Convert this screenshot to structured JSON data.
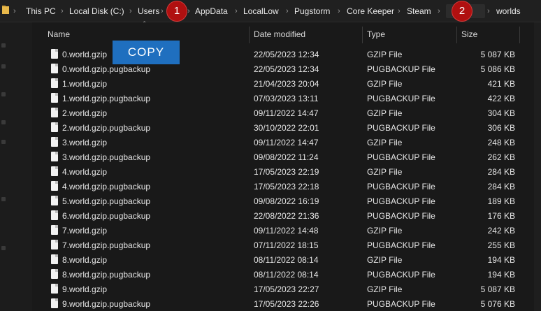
{
  "breadcrumb": {
    "items": [
      "This PC",
      "Local Disk (C:)",
      "Users",
      "AppData",
      "LocalLow",
      "Pugstorm",
      "Core Keeper",
      "Steam",
      "worlds"
    ],
    "separator": "›",
    "badges": [
      "1",
      "2"
    ]
  },
  "columns": {
    "name": "Name",
    "date": "Date modified",
    "type": "Type",
    "size": "Size"
  },
  "overlay": {
    "copy_label": "COPY"
  },
  "files": [
    {
      "name": "0.world.gzip",
      "date": "22/05/2023 12:34",
      "type": "GZIP File",
      "size": "5 087 KB"
    },
    {
      "name": "0.world.gzip.pugbackup",
      "date": "22/05/2023 12:34",
      "type": "PUGBACKUP File",
      "size": "5 086 KB"
    },
    {
      "name": "1.world.gzip",
      "date": "21/04/2023 20:04",
      "type": "GZIP File",
      "size": "421 KB"
    },
    {
      "name": "1.world.gzip.pugbackup",
      "date": "07/03/2023 13:11",
      "type": "PUGBACKUP File",
      "size": "422 KB"
    },
    {
      "name": "2.world.gzip",
      "date": "09/11/2022 14:47",
      "type": "GZIP File",
      "size": "304 KB"
    },
    {
      "name": "2.world.gzip.pugbackup",
      "date": "30/10/2022 22:01",
      "type": "PUGBACKUP File",
      "size": "306 KB"
    },
    {
      "name": "3.world.gzip",
      "date": "09/11/2022 14:47",
      "type": "GZIP File",
      "size": "248 KB"
    },
    {
      "name": "3.world.gzip.pugbackup",
      "date": "09/08/2022 11:24",
      "type": "PUGBACKUP File",
      "size": "262 KB"
    },
    {
      "name": "4.world.gzip",
      "date": "17/05/2023 22:19",
      "type": "GZIP File",
      "size": "284 KB"
    },
    {
      "name": "4.world.gzip.pugbackup",
      "date": "17/05/2023 22:18",
      "type": "PUGBACKUP File",
      "size": "284 KB"
    },
    {
      "name": "5.world.gzip.pugbackup",
      "date": "09/08/2022 16:19",
      "type": "PUGBACKUP File",
      "size": "189 KB"
    },
    {
      "name": "6.world.gzip.pugbackup",
      "date": "22/08/2022 21:36",
      "type": "PUGBACKUP File",
      "size": "176 KB"
    },
    {
      "name": "7.world.gzip",
      "date": "09/11/2022 14:48",
      "type": "GZIP File",
      "size": "242 KB"
    },
    {
      "name": "7.world.gzip.pugbackup",
      "date": "07/11/2022 18:15",
      "type": "PUGBACKUP File",
      "size": "255 KB"
    },
    {
      "name": "8.world.gzip",
      "date": "08/11/2022 08:14",
      "type": "GZIP File",
      "size": "194 KB"
    },
    {
      "name": "8.world.gzip.pugbackup",
      "date": "08/11/2022 08:14",
      "type": "PUGBACKUP File",
      "size": "194 KB"
    },
    {
      "name": "9.world.gzip",
      "date": "17/05/2023 22:27",
      "type": "GZIP File",
      "size": "5 087 KB"
    },
    {
      "name": "9.world.gzip.pugbackup",
      "date": "17/05/2023 22:26",
      "type": "PUGBACKUP File",
      "size": "5 076 KB"
    }
  ]
}
